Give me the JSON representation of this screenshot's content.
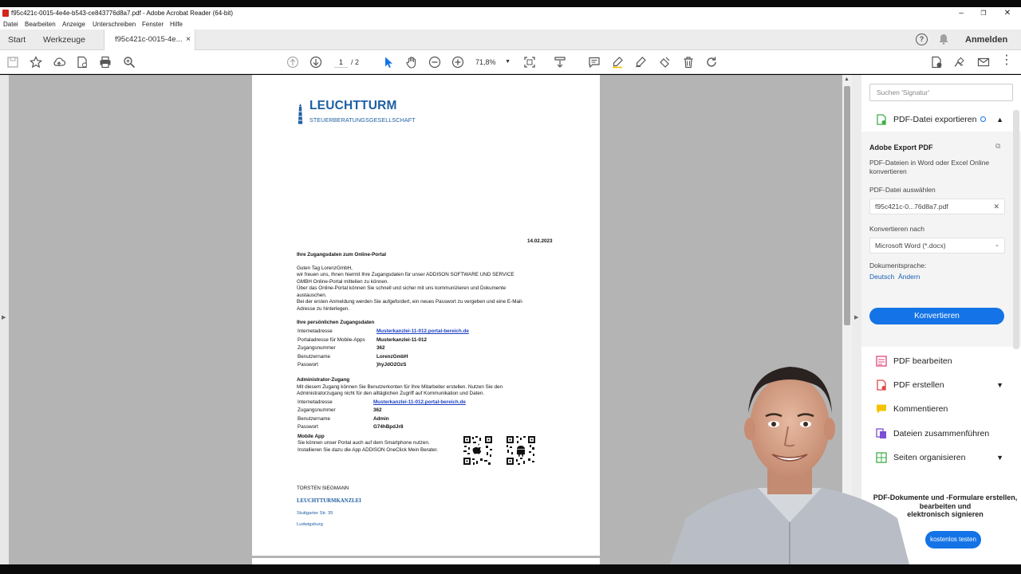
{
  "window": {
    "title": "f95c421c-0015-4e4e-b543-ce843776d8a7.pdf - Adobe Acrobat Reader (64-bit)",
    "minimize": "–",
    "maximize": "❐",
    "close": "✕"
  },
  "menu": [
    "Datei",
    "Bearbeiten",
    "Anzeige",
    "Unterschreiben",
    "Fenster",
    "Hilfe"
  ],
  "tabs": {
    "start": "Start",
    "tools": "Werkzeuge",
    "document": "f95c421c-0015-4e...",
    "close": "×",
    "help": "?",
    "login": "Anmelden"
  },
  "toolbar": {
    "page_current": "1",
    "page_total": "/ 2",
    "zoom": "71,8%"
  },
  "document": {
    "logo_name": "LEUCHTTURM",
    "logo_sub": "STEUERBERATUNGSGESELLSCHAFT",
    "date": "14.02.2023",
    "subject": "Ihre Zugangsdaten zum Online-Portal",
    "body": [
      "Guten Tag LorenzGmbH,",
      "wir freuen uns, Ihnen hiermit Ihre Zugangsdaten für unser ADDISON SOFTWARE UND SERVICE",
      "GMBH Online-Portal mitteilen zu können.",
      "Über das Online-Portal können Sie schnell und sicher mit uns kommunizieren und Dokumente",
      "austauschen.",
      "Bei der ersten Anmeldung werden Sie aufgefordert, ein neues Passwort zu vergeben und eine E-Mail-",
      "Adresse zu hinterlegen."
    ],
    "personal_heading": "Ihre persönlichen Zugangsdaten",
    "personal": [
      {
        "label": "Internetadresse",
        "value": "Musterkanzlei-11-012.portal-bereich.de"
      },
      {
        "label": "Portaladresse für Mobile-Apps",
        "value": "Musterkanzlei-11-012"
      },
      {
        "label": "Zugangsnummer",
        "value": "362"
      },
      {
        "label": "Benutzername",
        "value": "LorenzGmbH"
      },
      {
        "label": "Passwort",
        "value": ")hyJdO2OzS"
      }
    ],
    "admin_heading": "Administrator-Zugang",
    "admin_text": [
      "Mit diesem Zugang können Sie Benutzerkonten für Ihre Mitarbeiter erstellen. Nutzen Sie den",
      "Administratorzugang nicht für den alltäglichen Zugriff auf Kommunikation und Daten."
    ],
    "admin": [
      {
        "label": "Internetadresse",
        "value": "Musterkanzlei-11-012.portal-bereich.de"
      },
      {
        "label": "Zugangsnummer",
        "value": "362"
      },
      {
        "label": "Benutzername",
        "value": "Admin"
      },
      {
        "label": "Passwort",
        "value": "G74hBpdJr8"
      }
    ],
    "mobile_heading": "Mobile App",
    "mobile_text": [
      "Sie können unser Portal auch auf dem Smartphone nutzen.",
      "Installieren Sie dazu die App ADDISON OneClick Mein Berater."
    ],
    "signature_name": "TORSTEN SIEGMANN",
    "signature_firm": "LEUCHTTURMKANZLEI",
    "signature_street": "Stuttgarter Str. 35",
    "signature_city": "Ludwigsburg"
  },
  "panel": {
    "search_placeholder": "Suchen 'Signatur'",
    "export_title": "PDF-Datei exportieren",
    "export_heading": "Adobe Export PDF",
    "export_desc_1": "PDF-Dateien in Word oder Excel Online",
    "export_desc_2": "konvertieren",
    "select_label": "PDF-Datei auswählen",
    "selected_file": "f95c421c-0...76d8a7.pdf",
    "convert_to_label": "Konvertieren nach",
    "convert_to_value": "Microsoft Word (*.docx)",
    "language_label": "Dokumentsprache:",
    "language_value": "Deutsch",
    "language_change": "Ändern",
    "convert_button": "Konvertieren",
    "tools": [
      {
        "label": "PDF bearbeiten",
        "color": "#e0457b"
      },
      {
        "label": "PDF erstellen",
        "color": "#e04848"
      },
      {
        "label": "Kommentieren",
        "color": "#f5c400"
      },
      {
        "label": "Dateien zusammenführen",
        "color": "#7b4fd4"
      },
      {
        "label": "Seiten organisieren",
        "color": "#3fae49"
      }
    ],
    "promo_1": "PDF-Dokumente und -Formulare erstellen,",
    "promo_2": "bearbeiten und",
    "promo_3": "elektronisch signieren",
    "try_button": "kostenlos testen"
  },
  "colors": {
    "accent": "#1473e6",
    "logo_blue": "#1f5fa2",
    "link_blue": "#1a3fc2"
  }
}
